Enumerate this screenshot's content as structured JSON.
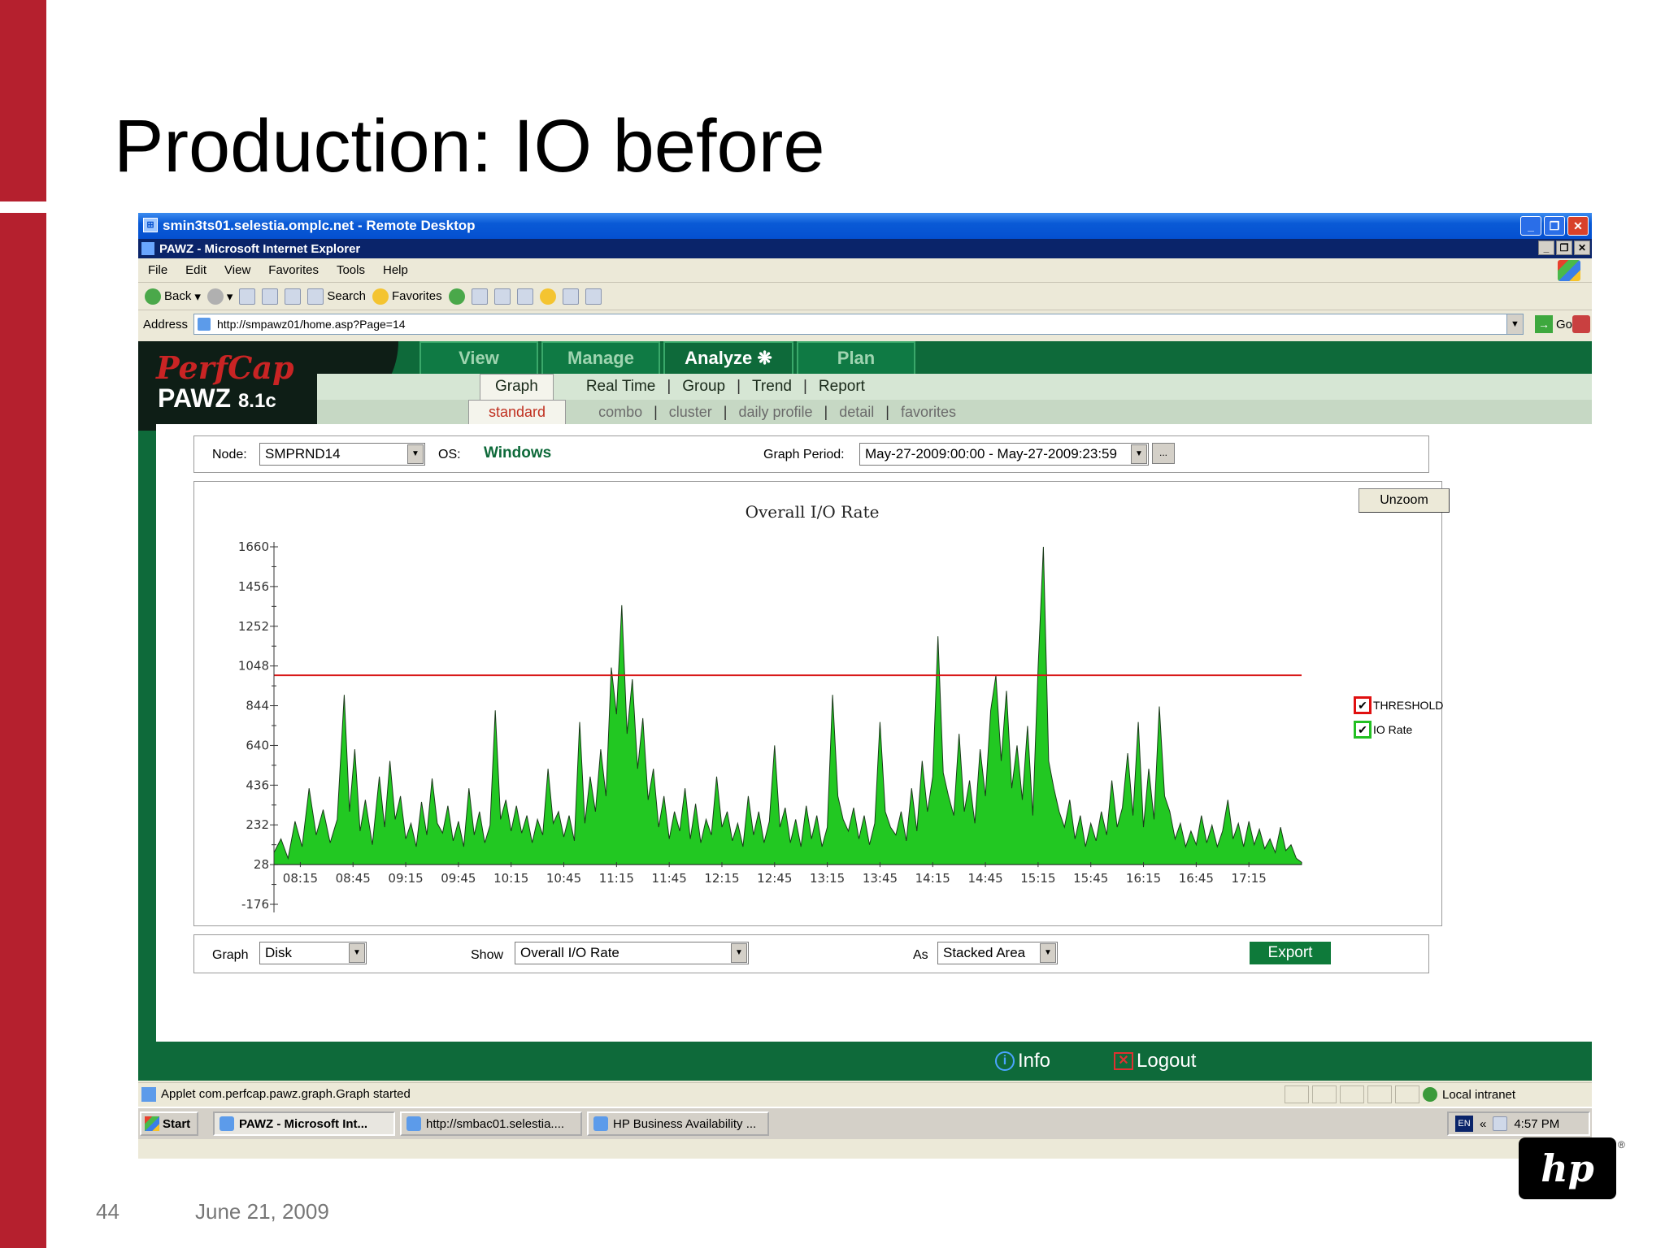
{
  "slide": {
    "title": "Production: IO before",
    "page_number": "44",
    "date": "June 21, 2009",
    "logo_text": "hp"
  },
  "remote_desktop": {
    "title": "smin3ts01.selestia.omplc.net - Remote Desktop"
  },
  "ie": {
    "title": "PAWZ - Microsoft Internet Explorer",
    "menu": [
      "File",
      "Edit",
      "View",
      "Favorites",
      "Tools",
      "Help"
    ],
    "toolbar": {
      "back": "Back",
      "search": "Search",
      "favorites": "Favorites"
    },
    "address_label": "Address",
    "address_value": "http://smpawz01/home.asp?Page=14",
    "go_label": "Go"
  },
  "app": {
    "logo_brand": "PerfCap",
    "logo_product": "PAWZ",
    "logo_version": "8.1c",
    "main_tabs": [
      "View",
      "Manage",
      "Analyze",
      "Plan"
    ],
    "active_main_tab": "Analyze",
    "sub_tabs": [
      "Graph",
      "Real Time",
      "Group",
      "Trend",
      "Report"
    ],
    "active_sub_tab": "Graph",
    "sub_sub_tabs": [
      "standard",
      "combo",
      "cluster",
      "daily profile",
      "detail",
      "favorites"
    ],
    "active_sub_sub_tab": "standard",
    "node_label": "Node:",
    "node_value": "SMPRND14",
    "os_label": "OS:",
    "os_value": "Windows",
    "graph_period_label": "Graph Period:",
    "graph_period_value": "May-27-2009:00:00 - May-27-2009:23:59",
    "dots_label": "...",
    "unzoom_label": "Unzoom",
    "legend": [
      {
        "label": "THRESHOLD",
        "color": "#e01010",
        "checked": true
      },
      {
        "label": "IO Rate",
        "color": "#22c022",
        "checked": true
      }
    ],
    "graph_label": "Graph",
    "graph_value": "Disk",
    "show_label": "Show",
    "show_value": "Overall I/O Rate",
    "as_label": "As",
    "as_value": "Stacked Area",
    "export_label": "Export",
    "info_label": "Info",
    "logout_label": "Logout"
  },
  "chart_data": {
    "type": "area",
    "title": "Overall I/O Rate",
    "xlabel": "",
    "ylabel": "",
    "yticks": [
      1660,
      1456,
      1252,
      1048,
      844,
      640,
      436,
      232,
      28,
      -176
    ],
    "ylim": [
      -176,
      1660
    ],
    "xticks": [
      "08:15",
      "08:45",
      "09:15",
      "09:45",
      "10:15",
      "10:45",
      "11:15",
      "11:45",
      "12:15",
      "12:45",
      "13:15",
      "13:45",
      "14:15",
      "14:45",
      "15:15",
      "15:45",
      "16:15",
      "16:45",
      "17:15"
    ],
    "x_start_minutes": 480,
    "x_end_minutes": 1065,
    "threshold": 1000,
    "series": [
      {
        "name": "IO Rate",
        "color": "#22c822",
        "points": [
          [
            480,
            90
          ],
          [
            484,
            160
          ],
          [
            488,
            60
          ],
          [
            492,
            250
          ],
          [
            496,
            120
          ],
          [
            500,
            420
          ],
          [
            504,
            180
          ],
          [
            508,
            310
          ],
          [
            512,
            140
          ],
          [
            516,
            260
          ],
          [
            520,
            900
          ],
          [
            523,
            300
          ],
          [
            526,
            620
          ],
          [
            529,
            200
          ],
          [
            532,
            360
          ],
          [
            536,
            130
          ],
          [
            540,
            480
          ],
          [
            543,
            220
          ],
          [
            546,
            560
          ],
          [
            549,
            260
          ],
          [
            552,
            380
          ],
          [
            555,
            160
          ],
          [
            558,
            240
          ],
          [
            561,
            120
          ],
          [
            564,
            350
          ],
          [
            567,
            180
          ],
          [
            570,
            470
          ],
          [
            573,
            240
          ],
          [
            576,
            190
          ],
          [
            579,
            330
          ],
          [
            582,
            150
          ],
          [
            585,
            250
          ],
          [
            588,
            120
          ],
          [
            591,
            420
          ],
          [
            594,
            180
          ],
          [
            597,
            300
          ],
          [
            600,
            140
          ],
          [
            603,
            230
          ],
          [
            606,
            820
          ],
          [
            609,
            260
          ],
          [
            612,
            360
          ],
          [
            615,
            200
          ],
          [
            618,
            330
          ],
          [
            621,
            190
          ],
          [
            624,
            280
          ],
          [
            627,
            140
          ],
          [
            630,
            260
          ],
          [
            633,
            180
          ],
          [
            636,
            520
          ],
          [
            639,
            240
          ],
          [
            642,
            300
          ],
          [
            645,
            170
          ],
          [
            648,
            280
          ],
          [
            651,
            150
          ],
          [
            654,
            760
          ],
          [
            657,
            240
          ],
          [
            660,
            480
          ],
          [
            663,
            300
          ],
          [
            666,
            620
          ],
          [
            669,
            380
          ],
          [
            672,
            1040
          ],
          [
            675,
            800
          ],
          [
            678,
            1360
          ],
          [
            681,
            700
          ],
          [
            684,
            980
          ],
          [
            687,
            520
          ],
          [
            690,
            780
          ],
          [
            693,
            360
          ],
          [
            696,
            520
          ],
          [
            699,
            220
          ],
          [
            702,
            380
          ],
          [
            705,
            160
          ],
          [
            708,
            300
          ],
          [
            711,
            200
          ],
          [
            714,
            420
          ],
          [
            717,
            160
          ],
          [
            720,
            340
          ],
          [
            723,
            140
          ],
          [
            726,
            260
          ],
          [
            729,
            180
          ],
          [
            732,
            480
          ],
          [
            735,
            220
          ],
          [
            738,
            300
          ],
          [
            741,
            150
          ],
          [
            744,
            240
          ],
          [
            747,
            120
          ],
          [
            750,
            380
          ],
          [
            753,
            180
          ],
          [
            756,
            300
          ],
          [
            759,
            140
          ],
          [
            762,
            250
          ],
          [
            765,
            640
          ],
          [
            768,
            220
          ],
          [
            771,
            320
          ],
          [
            774,
            140
          ],
          [
            777,
            260
          ],
          [
            780,
            120
          ],
          [
            783,
            330
          ],
          [
            786,
            160
          ],
          [
            789,
            280
          ],
          [
            792,
            120
          ],
          [
            795,
            220
          ],
          [
            798,
            900
          ],
          [
            801,
            380
          ],
          [
            804,
            260
          ],
          [
            807,
            200
          ],
          [
            810,
            320
          ],
          [
            813,
            160
          ],
          [
            816,
            280
          ],
          [
            819,
            130
          ],
          [
            822,
            240
          ],
          [
            825,
            760
          ],
          [
            828,
            300
          ],
          [
            831,
            220
          ],
          [
            834,
            180
          ],
          [
            837,
            300
          ],
          [
            840,
            150
          ],
          [
            843,
            420
          ],
          [
            846,
            200
          ],
          [
            849,
            560
          ],
          [
            852,
            300
          ],
          [
            855,
            480
          ],
          [
            858,
            1200
          ],
          [
            861,
            500
          ],
          [
            864,
            380
          ],
          [
            867,
            280
          ],
          [
            870,
            700
          ],
          [
            873,
            300
          ],
          [
            876,
            460
          ],
          [
            879,
            240
          ],
          [
            882,
            620
          ],
          [
            885,
            380
          ],
          [
            888,
            820
          ],
          [
            891,
            1000
          ],
          [
            894,
            560
          ],
          [
            897,
            920
          ],
          [
            900,
            420
          ],
          [
            903,
            640
          ],
          [
            906,
            360
          ],
          [
            909,
            740
          ],
          [
            912,
            280
          ],
          [
            915,
            1040
          ],
          [
            918,
            1660
          ],
          [
            921,
            560
          ],
          [
            924,
            420
          ],
          [
            927,
            300
          ],
          [
            930,
            220
          ],
          [
            933,
            360
          ],
          [
            936,
            160
          ],
          [
            939,
            280
          ],
          [
            942,
            120
          ],
          [
            945,
            240
          ],
          [
            948,
            150
          ],
          [
            951,
            300
          ],
          [
            954,
            180
          ],
          [
            957,
            460
          ],
          [
            960,
            220
          ],
          [
            963,
            320
          ],
          [
            966,
            600
          ],
          [
            969,
            280
          ],
          [
            972,
            760
          ],
          [
            975,
            220
          ],
          [
            978,
            520
          ],
          [
            981,
            260
          ],
          [
            984,
            840
          ],
          [
            987,
            380
          ],
          [
            990,
            300
          ],
          [
            993,
            160
          ],
          [
            996,
            240
          ],
          [
            999,
            120
          ],
          [
            1002,
            200
          ],
          [
            1005,
            130
          ],
          [
            1008,
            280
          ],
          [
            1011,
            140
          ],
          [
            1014,
            230
          ],
          [
            1017,
            120
          ],
          [
            1020,
            200
          ],
          [
            1023,
            360
          ],
          [
            1026,
            160
          ],
          [
            1029,
            240
          ],
          [
            1032,
            120
          ],
          [
            1035,
            250
          ],
          [
            1038,
            130
          ],
          [
            1041,
            210
          ],
          [
            1044,
            110
          ],
          [
            1047,
            160
          ],
          [
            1050,
            90
          ],
          [
            1053,
            220
          ],
          [
            1056,
            100
          ],
          [
            1059,
            130
          ],
          [
            1062,
            60
          ],
          [
            1065,
            40
          ]
        ]
      }
    ],
    "legend_placement": "right",
    "grid": false
  },
  "status": {
    "text": "Applet com.perfcap.pawz.graph.Graph started",
    "zone": "Local intranet"
  },
  "taskbar": {
    "start": "Start",
    "tasks": [
      "PAWZ - Microsoft Int...",
      "http://smbac01.selestia....",
      "HP Business Availability ..."
    ],
    "active_task": "PAWZ - Microsoft Int...",
    "lang": "EN",
    "tray_arrows": "«",
    "time": "4:57 PM"
  }
}
